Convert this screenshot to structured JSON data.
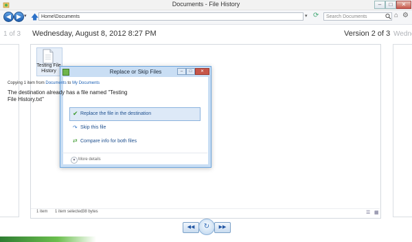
{
  "window": {
    "title": "Documents - File History",
    "min_glyph": "–",
    "max_glyph": "□",
    "close_glyph": "✕"
  },
  "toolbar": {
    "address": "Home\\Documents",
    "search_placeholder": "Search Documents",
    "icons": [
      "back-icon",
      "forward-icon",
      "up-icon",
      "refresh-icon",
      "search-icon",
      "home-icon",
      "gear-icon"
    ]
  },
  "versions": {
    "prev_label": "1 of 3",
    "timestamp": "Wednesday, August 8, 2012 8:27 PM",
    "current_label": "Version 2 of 3",
    "next_label": "Wedne"
  },
  "file": {
    "name_line1": "Testing File",
    "name_line2": "History"
  },
  "status": {
    "count": "1 item",
    "selected": "1 item selected",
    "size": "38 bytes"
  },
  "dialog": {
    "title": "Replace or Skip Files",
    "copy_prefix": "Copying 1 item from ",
    "copy_source": "Documents",
    "copy_mid": " to ",
    "copy_dest": "My Documents",
    "message": "The destination already has a file named \"Testing File History.txt\"",
    "options": {
      "replace": "Replace the file in the destination",
      "skip": "Skip this file",
      "compare": "Compare info for both files"
    },
    "more_details": "More details"
  },
  "colors": {
    "accent": "#2c71c8",
    "dialog_frame": "#c9def4",
    "option_text": "#1e4f8e",
    "close_red": "#c75649"
  }
}
